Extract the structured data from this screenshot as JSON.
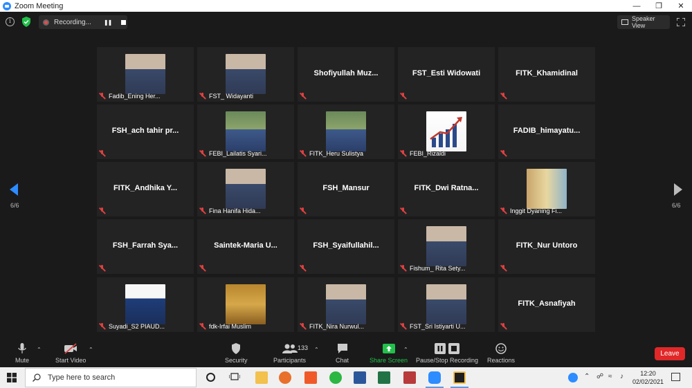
{
  "window": {
    "title": "Zoom Meeting"
  },
  "topbar": {
    "recording_label": "Recording...",
    "view_label": "Speaker View"
  },
  "page": {
    "left_indicator": "6/6",
    "right_indicator": "6/6"
  },
  "participants": [
    {
      "name": "Fadib_Ening Her...",
      "display": "",
      "photo": "photo-woman-hijab"
    },
    {
      "name": "FST_ Widayanti",
      "display": "",
      "photo": "photo-woman-hijab"
    },
    {
      "name": "",
      "display": "Shofiyullah  Muz...",
      "photo": ""
    },
    {
      "name": "",
      "display": "FST_Esti Widowati",
      "photo": ""
    },
    {
      "name": "",
      "display": "FITK_Khamidinal",
      "photo": ""
    },
    {
      "name": "",
      "display": "FSH_ach  tahir  pr...",
      "photo": ""
    },
    {
      "name": "FEBI_Lailatis Syari...",
      "display": "",
      "photo": "photo-group"
    },
    {
      "name": "FITK_Heru Sulistya",
      "display": "",
      "photo": "photo-group"
    },
    {
      "name": "FEBI_Rizaldi",
      "display": "",
      "photo": "photo-chart"
    },
    {
      "name": "",
      "display": "FADIB_himayatu...",
      "photo": ""
    },
    {
      "name": "",
      "display": "FITK_Andhika  Y...",
      "photo": ""
    },
    {
      "name": "Fina Hanifa Hida...",
      "display": "",
      "photo": "photo-woman-hijab"
    },
    {
      "name": "",
      "display": "FSH_Mansur",
      "photo": ""
    },
    {
      "name": "",
      "display": "FITK_Dwi  Ratna...",
      "photo": ""
    },
    {
      "name": "Inggit Dyaning Fi...",
      "display": "",
      "photo": "photo-room"
    },
    {
      "name": "",
      "display": "FSH_Farrah  Sya...",
      "photo": ""
    },
    {
      "name": "",
      "display": "Saintek-Maria  U...",
      "photo": ""
    },
    {
      "name": "",
      "display": "FSH_Syaifullahil...",
      "photo": ""
    },
    {
      "name": "Fishum_ Rita Sety...",
      "display": "",
      "photo": "photo-woman-hijab"
    },
    {
      "name": "",
      "display": "FITK_Nur Untoro",
      "photo": ""
    },
    {
      "name": "Suyadi_S2 PIAUD...",
      "display": "",
      "photo": "photo-banner"
    },
    {
      "name": "fdk-Irfai Muslim",
      "display": "",
      "photo": "photo-poster"
    },
    {
      "name": "FITK_Nira Nurwul...",
      "display": "",
      "photo": "photo-woman-hijab"
    },
    {
      "name": "FST_Sri Istiyarti U...",
      "display": "",
      "photo": "photo-woman-hijab"
    },
    {
      "name": "",
      "display": "FITK_Asnafiyah",
      "photo": ""
    }
  ],
  "toolbar": {
    "mute": "Mute",
    "video": "Start Video",
    "security": "Security",
    "participants": "Participants",
    "participants_count": "133",
    "chat": "Chat",
    "share": "Share Screen",
    "record": "Pause/Stop Recording",
    "reactions": "Reactions",
    "leave": "Leave"
  },
  "taskbar": {
    "search_placeholder": "Type here to search",
    "time": "12:20",
    "date": "02/02/2021"
  },
  "colors": {
    "accent": "#2d8cff",
    "share_green": "#22c04a",
    "leave_red": "#e02828",
    "muted_red": "#e04040"
  }
}
